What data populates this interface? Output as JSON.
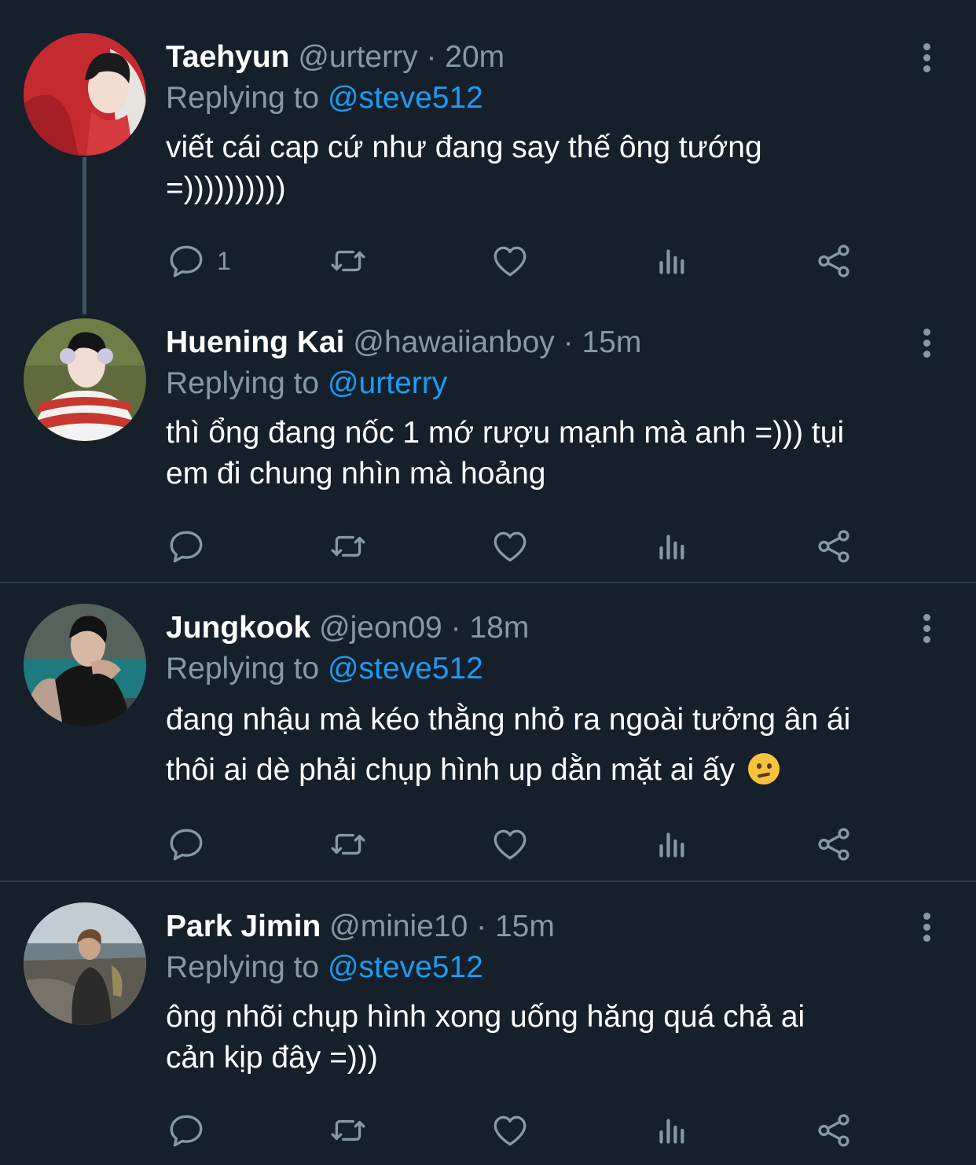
{
  "colors": {
    "background": "#15202b",
    "secondary_text": "#8899a6",
    "mention": "#1d9bf0",
    "divider": "#2f3d4a"
  },
  "icons": {
    "reply": "reply-icon",
    "retweet": "retweet-icon",
    "like": "heart-icon",
    "analytics": "analytics-icon",
    "share": "share-icon",
    "more": "more-icon"
  },
  "tweets": [
    {
      "name": "Taehyun",
      "handle": "@urterry",
      "separator": "·",
      "time": "20m",
      "replying_prefix": "Replying to",
      "replying_to": "@steve512",
      "line1": "viết cái cap cứ như đang say thế ông tướng",
      "line2": "=))))))))))",
      "reply_count": "1"
    },
    {
      "name": "Huening Kai",
      "handle": "@hawaiianboy",
      "separator": "·",
      "time": "15m",
      "replying_prefix": "Replying to",
      "replying_to": "@urterry",
      "line1": "thì ổng đang nốc 1 mớ rượu mạnh mà anh =))) tụi",
      "line2": "em đi chung nhìn mà hoảng",
      "reply_count": ""
    },
    {
      "name": "Jungkook",
      "handle": "@jeon09",
      "separator": "·",
      "time": "18m",
      "replying_prefix": "Replying to",
      "replying_to": "@steve512",
      "line1": "đang nhậu mà kéo thằng nhỏ ra ngoài tưởng ân ái",
      "line2": "thôi ai dè phải chụp hình up dằn mặt ai ấy",
      "reply_count": ""
    },
    {
      "name": "Park Jimin",
      "handle": "@minie10",
      "separator": "·",
      "time": "15m",
      "replying_prefix": "Replying to",
      "replying_to": "@steve512",
      "line1": "ông nhõi chụp hình xong uống hăng quá chả ai",
      "line2": "cản kịp đây =)))",
      "reply_count": ""
    }
  ]
}
